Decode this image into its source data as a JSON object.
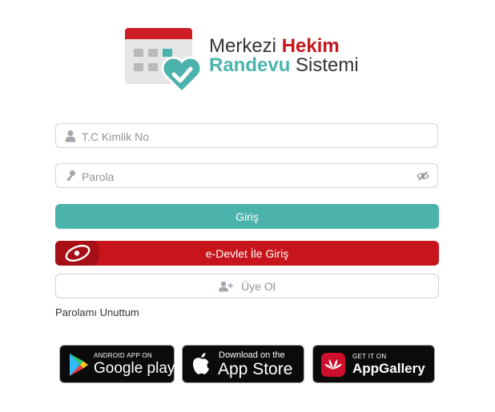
{
  "logo": {
    "word1": "Merkezi",
    "word2": "Hekim",
    "word3": "Randevu",
    "word4": "Sistemi"
  },
  "form": {
    "tc_placeholder": "T.C Kimlik No",
    "password_placeholder": "Parola",
    "login_label": "Giriş",
    "edevlet_label": "e-Devlet İle Giriş",
    "register_label": "Üye Ol",
    "forgot_label": "Parolamı Unuttum"
  },
  "stores": {
    "google": {
      "small": "ANDROID APP ON",
      "big": "Google play"
    },
    "apple": {
      "small": "Download on the",
      "big": "App Store"
    },
    "huawei": {
      "small": "GET IT ON",
      "big": "AppGallery"
    }
  },
  "colors": {
    "brand_teal": "#4cb2ac",
    "brand_red": "#c4161c",
    "edevlet_red": "#c8141b",
    "border": "#cfd4d9"
  }
}
